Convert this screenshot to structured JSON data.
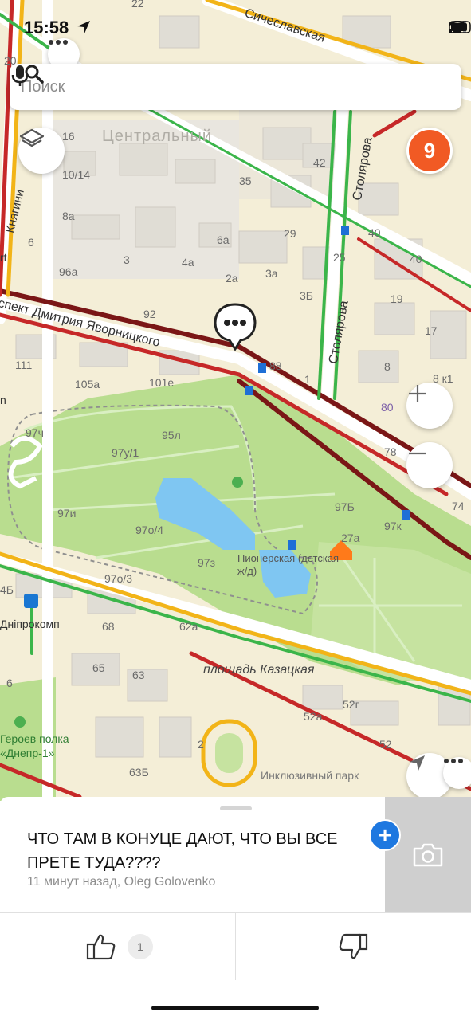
{
  "status": {
    "time": "15:58"
  },
  "search": {
    "placeholder": "Поиск"
  },
  "map": {
    "traffic_badge": "9",
    "streets": {
      "sicheslavska": "Сичеславская",
      "yavornytskoho": "спект Дмитрия Яворницкого",
      "stoliarova_1": "Столярова",
      "stoliarova_2": "Столярова",
      "kniahyni": "Княгини",
      "kazatskaya": "площадь Казацкая"
    },
    "districts": {
      "central": "Центральный"
    },
    "places": {
      "pionerskaya": "Пионерская (детская ж/д)",
      "dniprokomp": "Дніпрокомп",
      "geroev_polka": "Героев полка «Днепр-1»",
      "inclusive_park": "Инклюзивный парк"
    },
    "house_numbers": [
      "22",
      "20",
      "16",
      "10/14",
      "8а",
      "6",
      "96а",
      "3",
      "4а",
      "2а",
      "3а",
      "3Б",
      "6а",
      "35",
      "29",
      "42",
      "40",
      "40",
      "25",
      "19",
      "17",
      "8",
      "8 к1",
      "80",
      "78",
      "74",
      "92",
      "88",
      "1",
      "111",
      "105а",
      "101е",
      "97ч",
      "95л",
      "97у/1",
      "97и",
      "97о/4",
      "97з",
      "97Б",
      "27а",
      "97к",
      "97о/3",
      "4Б",
      "68",
      "62а",
      "65",
      "63",
      "52г",
      "52а",
      "52",
      "2",
      "63Б",
      "6",
      "rt",
      "n"
    ]
  },
  "post": {
    "text": "ЧТО ТАМ В КОНУЦЕ ДАЮТ, ЧТО ВЫ ВСЕ ПРЕТЕ ТУДА????",
    "meta": "11 минут назад, Oleg Golovenko",
    "likes": "1"
  },
  "colors": {
    "traffic_red": "#c62828",
    "traffic_dark": "#7a1616",
    "traffic_green": "#3bb54a",
    "traffic_yellow": "#f2b418",
    "park": "#b9dd8f",
    "water": "#7fc6f2",
    "accent_orange": "#f15a24",
    "accent_blue": "#1e78e0"
  }
}
